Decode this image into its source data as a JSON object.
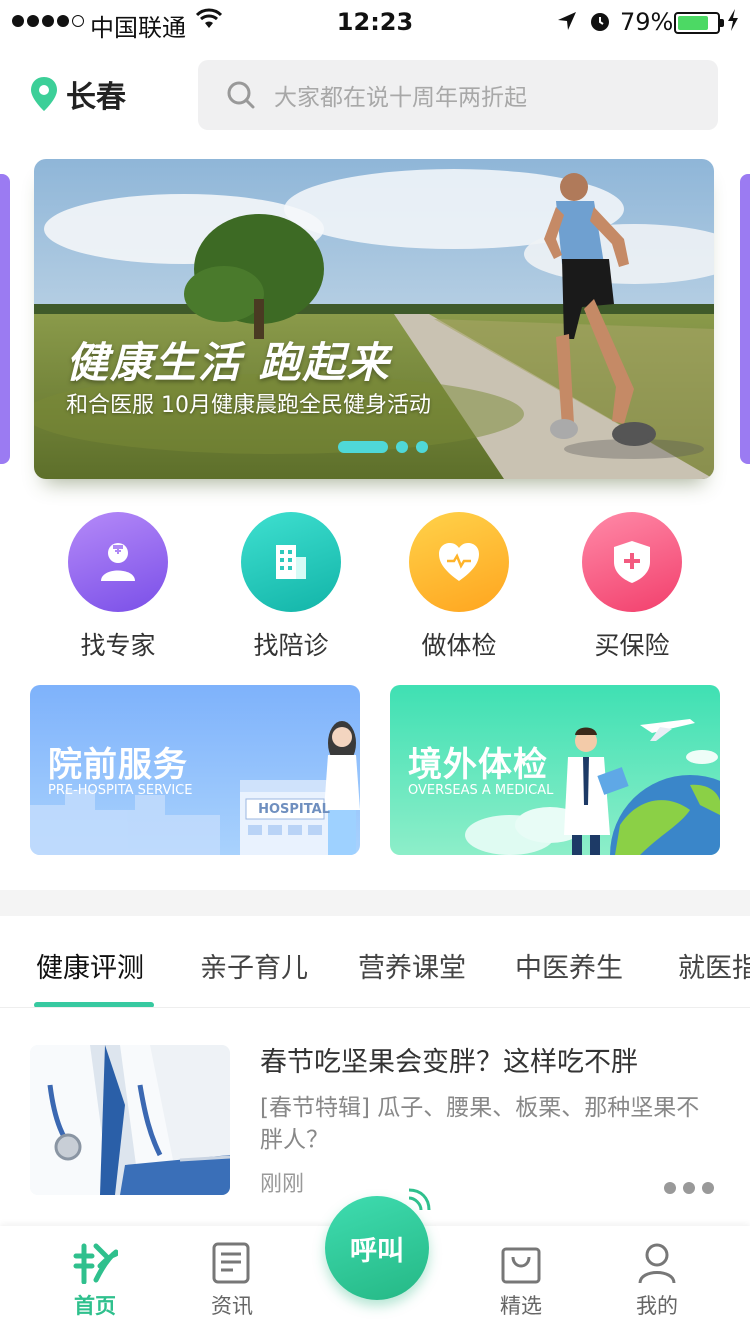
{
  "status_bar": {
    "carrier": "中国联通",
    "time": "12:23",
    "battery_pct": "79%"
  },
  "header": {
    "city": "长春",
    "search_placeholder": "大家都在说十周年两折起"
  },
  "banner": {
    "title": "健康生活 跑起来",
    "subtitle": "和合医服 10月健康晨跑全民健身活动"
  },
  "quick_menu": [
    {
      "label": "找专家",
      "color_from": "#b58af8",
      "color_to": "#7a4fe8"
    },
    {
      "label": "找陪诊",
      "color_from": "#3fe0d0",
      "color_to": "#12b4a8"
    },
    {
      "label": "做体检",
      "color_from": "#ffd24a",
      "color_to": "#ffa51f"
    },
    {
      "label": "买保险",
      "color_from": "#ff8aa8",
      "color_to": "#f23f6c"
    }
  ],
  "cards": [
    {
      "title": "院前服务",
      "subtitle": "PRE-HOSPITA SERVICE"
    },
    {
      "title": "境外体检",
      "subtitle": "OVERSEAS A MEDICAL"
    }
  ],
  "card_sign": "HOSPITAL",
  "tabs": [
    "健康评测",
    "亲子育儿",
    "营养课堂",
    "中医养生",
    "就医指"
  ],
  "article": {
    "title": "春节吃坚果会变胖？这样吃不胖",
    "desc": "[春节特辑] 瓜子、腰果、板栗、那种坚果不胖人？",
    "time": "刚刚"
  },
  "tab_bar": {
    "home": "首页",
    "news": "资讯",
    "call": "呼叫",
    "picks": "精选",
    "mine": "我的"
  },
  "colors": {
    "accent": "#37c9a0",
    "banner_side": "#9b7bf2"
  }
}
